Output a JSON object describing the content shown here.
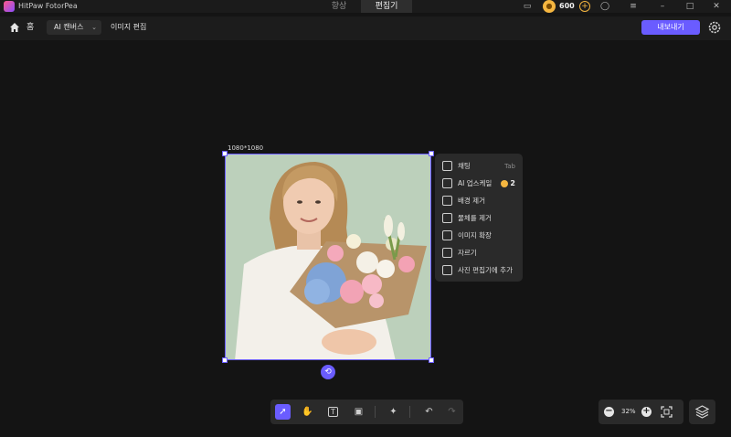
{
  "titlebar": {
    "app_name": "HitPaw FotorPea",
    "tabs": [
      "향상",
      "편집기"
    ],
    "active_tab": 1,
    "credits": "600"
  },
  "toolbar": {
    "home_label": "홈",
    "canvas_mode": "AI 캔버스",
    "section_label": "이미지 편집",
    "export_label": "내보내기"
  },
  "canvas": {
    "image_dimensions": "1080*1080"
  },
  "context_menu": {
    "items": [
      {
        "label": "채팅",
        "hint": "Tab",
        "icon": "chat-sparkle-icon"
      },
      {
        "label": "AI 업스케일",
        "cost": "2",
        "icon": "upscale-icon"
      },
      {
        "label": "배경 제거",
        "icon": "background-remove-icon"
      },
      {
        "label": "물체를 제거",
        "icon": "eraser-icon"
      },
      {
        "label": "이미지 확장",
        "icon": "expand-icon"
      },
      {
        "label": "자르기",
        "icon": "scissors-icon"
      },
      {
        "label": "사진 편집기에 추가",
        "icon": "add-to-editor-icon"
      }
    ]
  },
  "bottom_tools": {
    "tools": [
      "select-icon",
      "hand-icon",
      "text-icon",
      "add-image-icon",
      "ai-chat-icon",
      "undo-icon",
      "redo-icon"
    ],
    "active": "select-icon"
  },
  "zoom": {
    "value": "32%"
  },
  "colors": {
    "accent": "#6a5cff",
    "coin": "#f5b640",
    "background": "#141414"
  }
}
